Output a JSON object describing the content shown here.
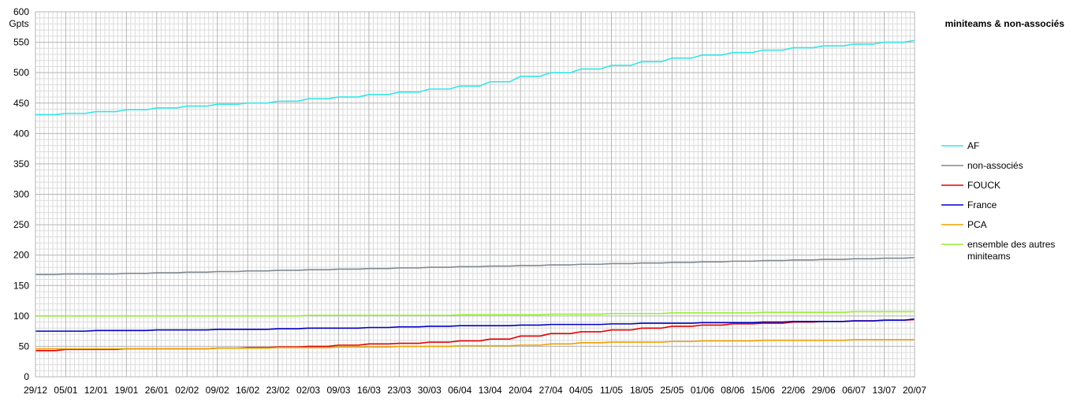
{
  "chart_data": {
    "type": "line",
    "title": "miniteams & non-associés",
    "ylabel": "Gpts",
    "xlabel": "",
    "ylim": [
      0,
      600
    ],
    "yticks": [
      0,
      50,
      100,
      150,
      200,
      250,
      300,
      350,
      400,
      450,
      500,
      550,
      600
    ],
    "categories": [
      "29/12",
      "05/01",
      "12/01",
      "19/01",
      "26/01",
      "02/02",
      "09/02",
      "16/02",
      "23/02",
      "02/03",
      "09/03",
      "16/03",
      "23/03",
      "30/03",
      "06/04",
      "13/04",
      "20/04",
      "27/04",
      "04/05",
      "11/05",
      "18/05",
      "25/05",
      "01/06",
      "08/06",
      "15/06",
      "22/06",
      "29/06",
      "06/07",
      "13/07",
      "20/07"
    ],
    "grid": true,
    "legend_position": "right",
    "series": [
      {
        "name": "AF",
        "color": "#33e6e6",
        "values": [
          431,
          433,
          436,
          439,
          442,
          445,
          448,
          450,
          453,
          457,
          460,
          464,
          468,
          473,
          478,
          485,
          494,
          500,
          506,
          512,
          518,
          524,
          529,
          533,
          537,
          541,
          544,
          547,
          550,
          553
        ]
      },
      {
        "name": "non-associés",
        "color": "#808890",
        "values": [
          168,
          169,
          169,
          170,
          171,
          172,
          173,
          174,
          175,
          176,
          177,
          178,
          179,
          180,
          181,
          182,
          183,
          184,
          185,
          186,
          187,
          188,
          189,
          190,
          191,
          192,
          193,
          194,
          195,
          196
        ]
      },
      {
        "name": "FOUCK",
        "color": "#e60000",
        "values": [
          43,
          45,
          45,
          46,
          46,
          46,
          47,
          48,
          49,
          50,
          52,
          54,
          55,
          57,
          59,
          62,
          67,
          71,
          74,
          77,
          80,
          83,
          85,
          87,
          88,
          90,
          91,
          92,
          93,
          94
        ]
      },
      {
        "name": "France",
        "color": "#0000c8",
        "values": [
          75,
          75,
          76,
          76,
          77,
          77,
          78,
          78,
          79,
          80,
          80,
          81,
          82,
          83,
          84,
          84,
          85,
          86,
          86,
          87,
          88,
          88,
          89,
          89,
          90,
          91,
          91,
          92,
          93,
          95
        ]
      },
      {
        "name": "PCA",
        "color": "#f0a000",
        "values": [
          46,
          46,
          46,
          46,
          46,
          46,
          47,
          47,
          48,
          48,
          49,
          49,
          50,
          50,
          51,
          51,
          52,
          54,
          56,
          57,
          57,
          58,
          59,
          59,
          60,
          60,
          60,
          61,
          61,
          61
        ]
      },
      {
        "name": "ensemble des autres miniteams",
        "legend_lines": [
          "ensemble des autres",
          "miniteams"
        ],
        "color": "#99ee33",
        "values": [
          100,
          100,
          100,
          100,
          100,
          100,
          100,
          100,
          100,
          101,
          101,
          101,
          101,
          101,
          102,
          102,
          102,
          103,
          103,
          104,
          104,
          105,
          105,
          105,
          106,
          106,
          106,
          107,
          107,
          107
        ]
      }
    ]
  }
}
